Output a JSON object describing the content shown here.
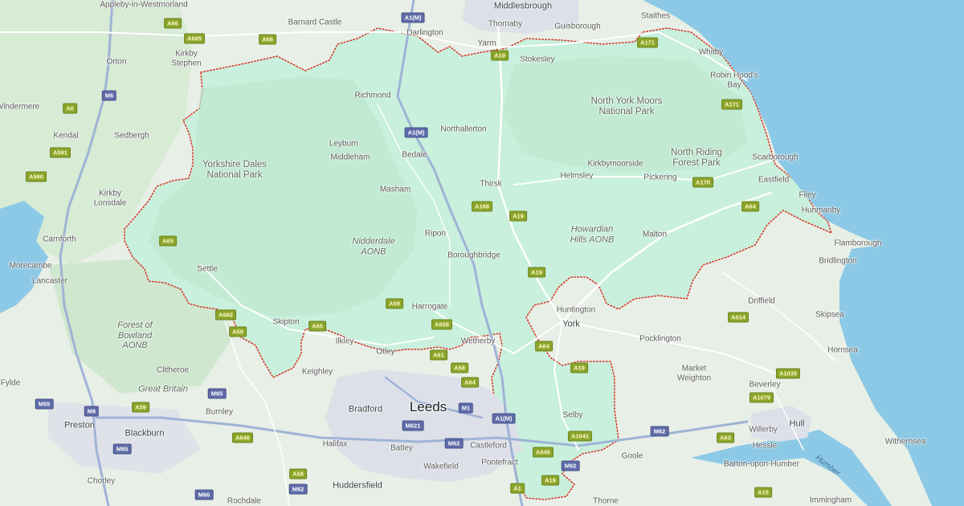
{
  "map": {
    "colors": {
      "land": "#e8efe6",
      "park": "#cfe9d2",
      "region_fill": "#c8f0dc",
      "sea": "#8cc9e6",
      "urban": "#dadde6",
      "boundary": "#d93025",
      "road": "#ffffff",
      "motorway": "#9fb3d6"
    },
    "labels": {
      "appleby": "Appleby-in-Westmorland",
      "middlesbrough": "Middlesbrough",
      "barnard_castle": "Barnard Castle",
      "darlington": "Darlington",
      "thornaby": "Thornaby",
      "guisborough": "Guisborough",
      "staithes": "Staithes",
      "yarm": "Yarm",
      "stokesley": "Stokesley",
      "whitby": "Whitby",
      "robin_hoods_bay": "Robin Hood's Bay",
      "orton": "Orton",
      "kirkby_stephen": "Kirkby Stephen",
      "windermere": "Windermere",
      "kendal": "Kendal",
      "sedbergh": "Sedbergh",
      "richmond": "Richmond",
      "northallerton": "Northallerton",
      "north_york_moors": "North York Moors National Park",
      "leyburn": "Leyburn",
      "middleham": "Middleham",
      "bedale": "Bedale",
      "north_riding_forest": "North Riding Forest Park",
      "scarborough": "Scarborough",
      "yorkshire_dales": "Yorkshire Dales National Park",
      "kirkbymoorside": "Kirkbymoorside",
      "helmsley": "Helmsley",
      "pickering": "Pickering",
      "eastfield": "Eastfield",
      "thirsk": "Thirsk",
      "masham": "Masham",
      "kirkby_lonsdale": "Kirkby Lonsdale",
      "filey": "Filey",
      "hunmanby": "Hunmanby",
      "howardian_hills": "Howardian Hills AONB",
      "malton": "Malton",
      "ripon": "Ripon",
      "carnforth": "Carnforth",
      "nidderdale": "Nidderdale AONB",
      "flamborough": "Flamborough",
      "bridlington": "Bridlington",
      "boroughbridge": "Boroughbridge",
      "morecambe": "Morecambe",
      "settle": "Settle",
      "lancaster": "Lancaster",
      "driffield": "Driffield",
      "huntington": "Huntington",
      "harrogate": "Harrogate",
      "skipton": "Skipton",
      "york": "York",
      "skipsea": "Skipsea",
      "forest_of_bowland": "Forest of Bowland AONB",
      "pocklington": "Pocklington",
      "ilkley": "Ilkley",
      "otley": "Otley",
      "wetherby": "Wetherby",
      "hornsea": "Hornsea",
      "keighley": "Keighley",
      "clitheroe": "Clitheroe",
      "market_weighton": "Market Weighton",
      "beverley": "Beverley",
      "fylde": "Fylde",
      "great_britain": "Great Britain",
      "bradford": "Bradford",
      "leeds": "Leeds",
      "preston": "Preston",
      "burnley": "Burnley",
      "selby": "Selby",
      "hull": "Hull",
      "willerby": "Willerby",
      "blackburn": "Blackburn",
      "halifax": "Halifax",
      "batley": "Batley",
      "castleford": "Castleford",
      "hessle": "Hessle",
      "withernsea": "Withernsea",
      "goole": "Goole",
      "wakefield": "Wakefield",
      "pontefract": "Pontefract",
      "barton_upon_humber": "Barton-upon-Humber",
      "humber": "Humber",
      "chorley": "Chorley",
      "huddersfield": "Huddersfield",
      "rochdale": "Rochdale",
      "thorne": "Thorne",
      "immingham": "Immingham"
    },
    "road_shields": {
      "a1m_north": "A1(M)",
      "a66_west": "A66",
      "a685": "A685",
      "a66_mid": "A66",
      "a19_north": "A19",
      "a171_north": "A171",
      "a171_east": "A171",
      "a6": "A6",
      "m6_north": "M6",
      "a1m_mid": "A1(M)",
      "a591": "A591",
      "a590": "A590",
      "a170": "A170",
      "a64_east": "A64",
      "a168": "A168",
      "a19_mid": "A19",
      "a65_west": "A65",
      "a19_south": "A19",
      "a59_harrogate": "A59",
      "a614": "A614",
      "a682": "A682",
      "a65_skipton": "A65",
      "a658": "A658",
      "a59_west": "A59",
      "a64_york": "A64",
      "a61": "A61",
      "a19_selby": "A19",
      "a58": "A58",
      "a1035": "A1035",
      "a64_leeds": "A64",
      "a1079": "A1079",
      "m65_north": "M65",
      "m55": "M55",
      "m6_mid": "M6",
      "m1": "M1",
      "a59_lower": "A59",
      "a1m_south": "A1(M)",
      "m621": "M621",
      "a1041": "A1041",
      "m62_east": "M62",
      "a63": "A63",
      "a646": "A646",
      "m62_mid": "M62",
      "m65_south": "M65",
      "a645": "A645",
      "m62_south": "M62",
      "a58_lower": "A58",
      "m62_west": "M62",
      "a1": "A1",
      "a19_bottom": "A19",
      "a15": "A15",
      "m66": "M66"
    }
  }
}
